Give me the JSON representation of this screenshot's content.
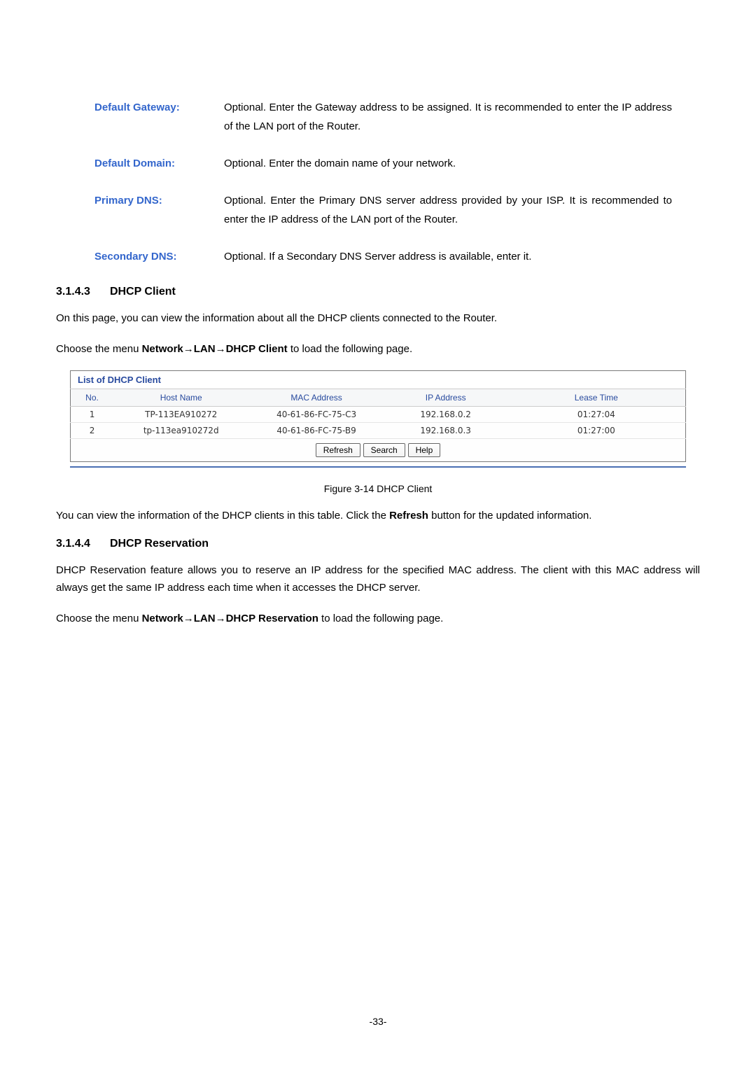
{
  "definitions": [
    {
      "label": "Default Gateway:",
      "text": "Optional. Enter the Gateway address to be assigned. It is recommended to enter the IP address of the LAN port of the Router."
    },
    {
      "label": "Default Domain:",
      "text": "Optional. Enter the domain name of your network."
    },
    {
      "label": "Primary DNS:",
      "text": "Optional. Enter the Primary DNS server address provided by your ISP. It is recommended to enter the IP address of the LAN port of the Router."
    },
    {
      "label": "Secondary DNS:",
      "text": "Optional. If a Secondary DNS Server address is available, enter it."
    }
  ],
  "section1": {
    "num": "3.1.4.3",
    "title": "DHCP Client"
  },
  "intro1": "On this page, you can view the information about all the DHCP clients connected to the Router.",
  "menu1": {
    "pre": "Choose the menu ",
    "path": "Network→LAN→DHCP Client",
    "post": " to load the following page."
  },
  "dhcp_table": {
    "title": "List of DHCP Client",
    "headers": {
      "no": "No.",
      "host": "Host Name",
      "mac": "MAC Address",
      "ip": "IP Address",
      "lease": "Lease Time"
    },
    "rows": [
      {
        "no": "1",
        "host": "TP-113EA910272",
        "mac": "40-61-86-FC-75-C3",
        "ip": "192.168.0.2",
        "lease": "01:27:04"
      },
      {
        "no": "2",
        "host": "tp-113ea910272d",
        "mac": "40-61-86-FC-75-B9",
        "ip": "192.168.0.3",
        "lease": "01:27:00"
      }
    ],
    "buttons": {
      "refresh": "Refresh",
      "search": "Search",
      "help": "Help"
    }
  },
  "caption1": "Figure 3-14 DHCP Client",
  "aftertable": {
    "pre": "You can view the information of the DHCP clients in this table. Click the ",
    "bold": "Refresh",
    "post": " button for the updated information."
  },
  "section2": {
    "num": "3.1.4.4",
    "title": "DHCP Reservation"
  },
  "intro2": "DHCP Reservation feature allows you to reserve an IP address for the specified MAC address. The client with this MAC address will always get the same IP address each time when it accesses the DHCP server.",
  "menu2": {
    "pre": "Choose the menu ",
    "path": "Network→LAN→DHCP Reservation",
    "post": " to load the following page."
  },
  "page_number": "-33-"
}
